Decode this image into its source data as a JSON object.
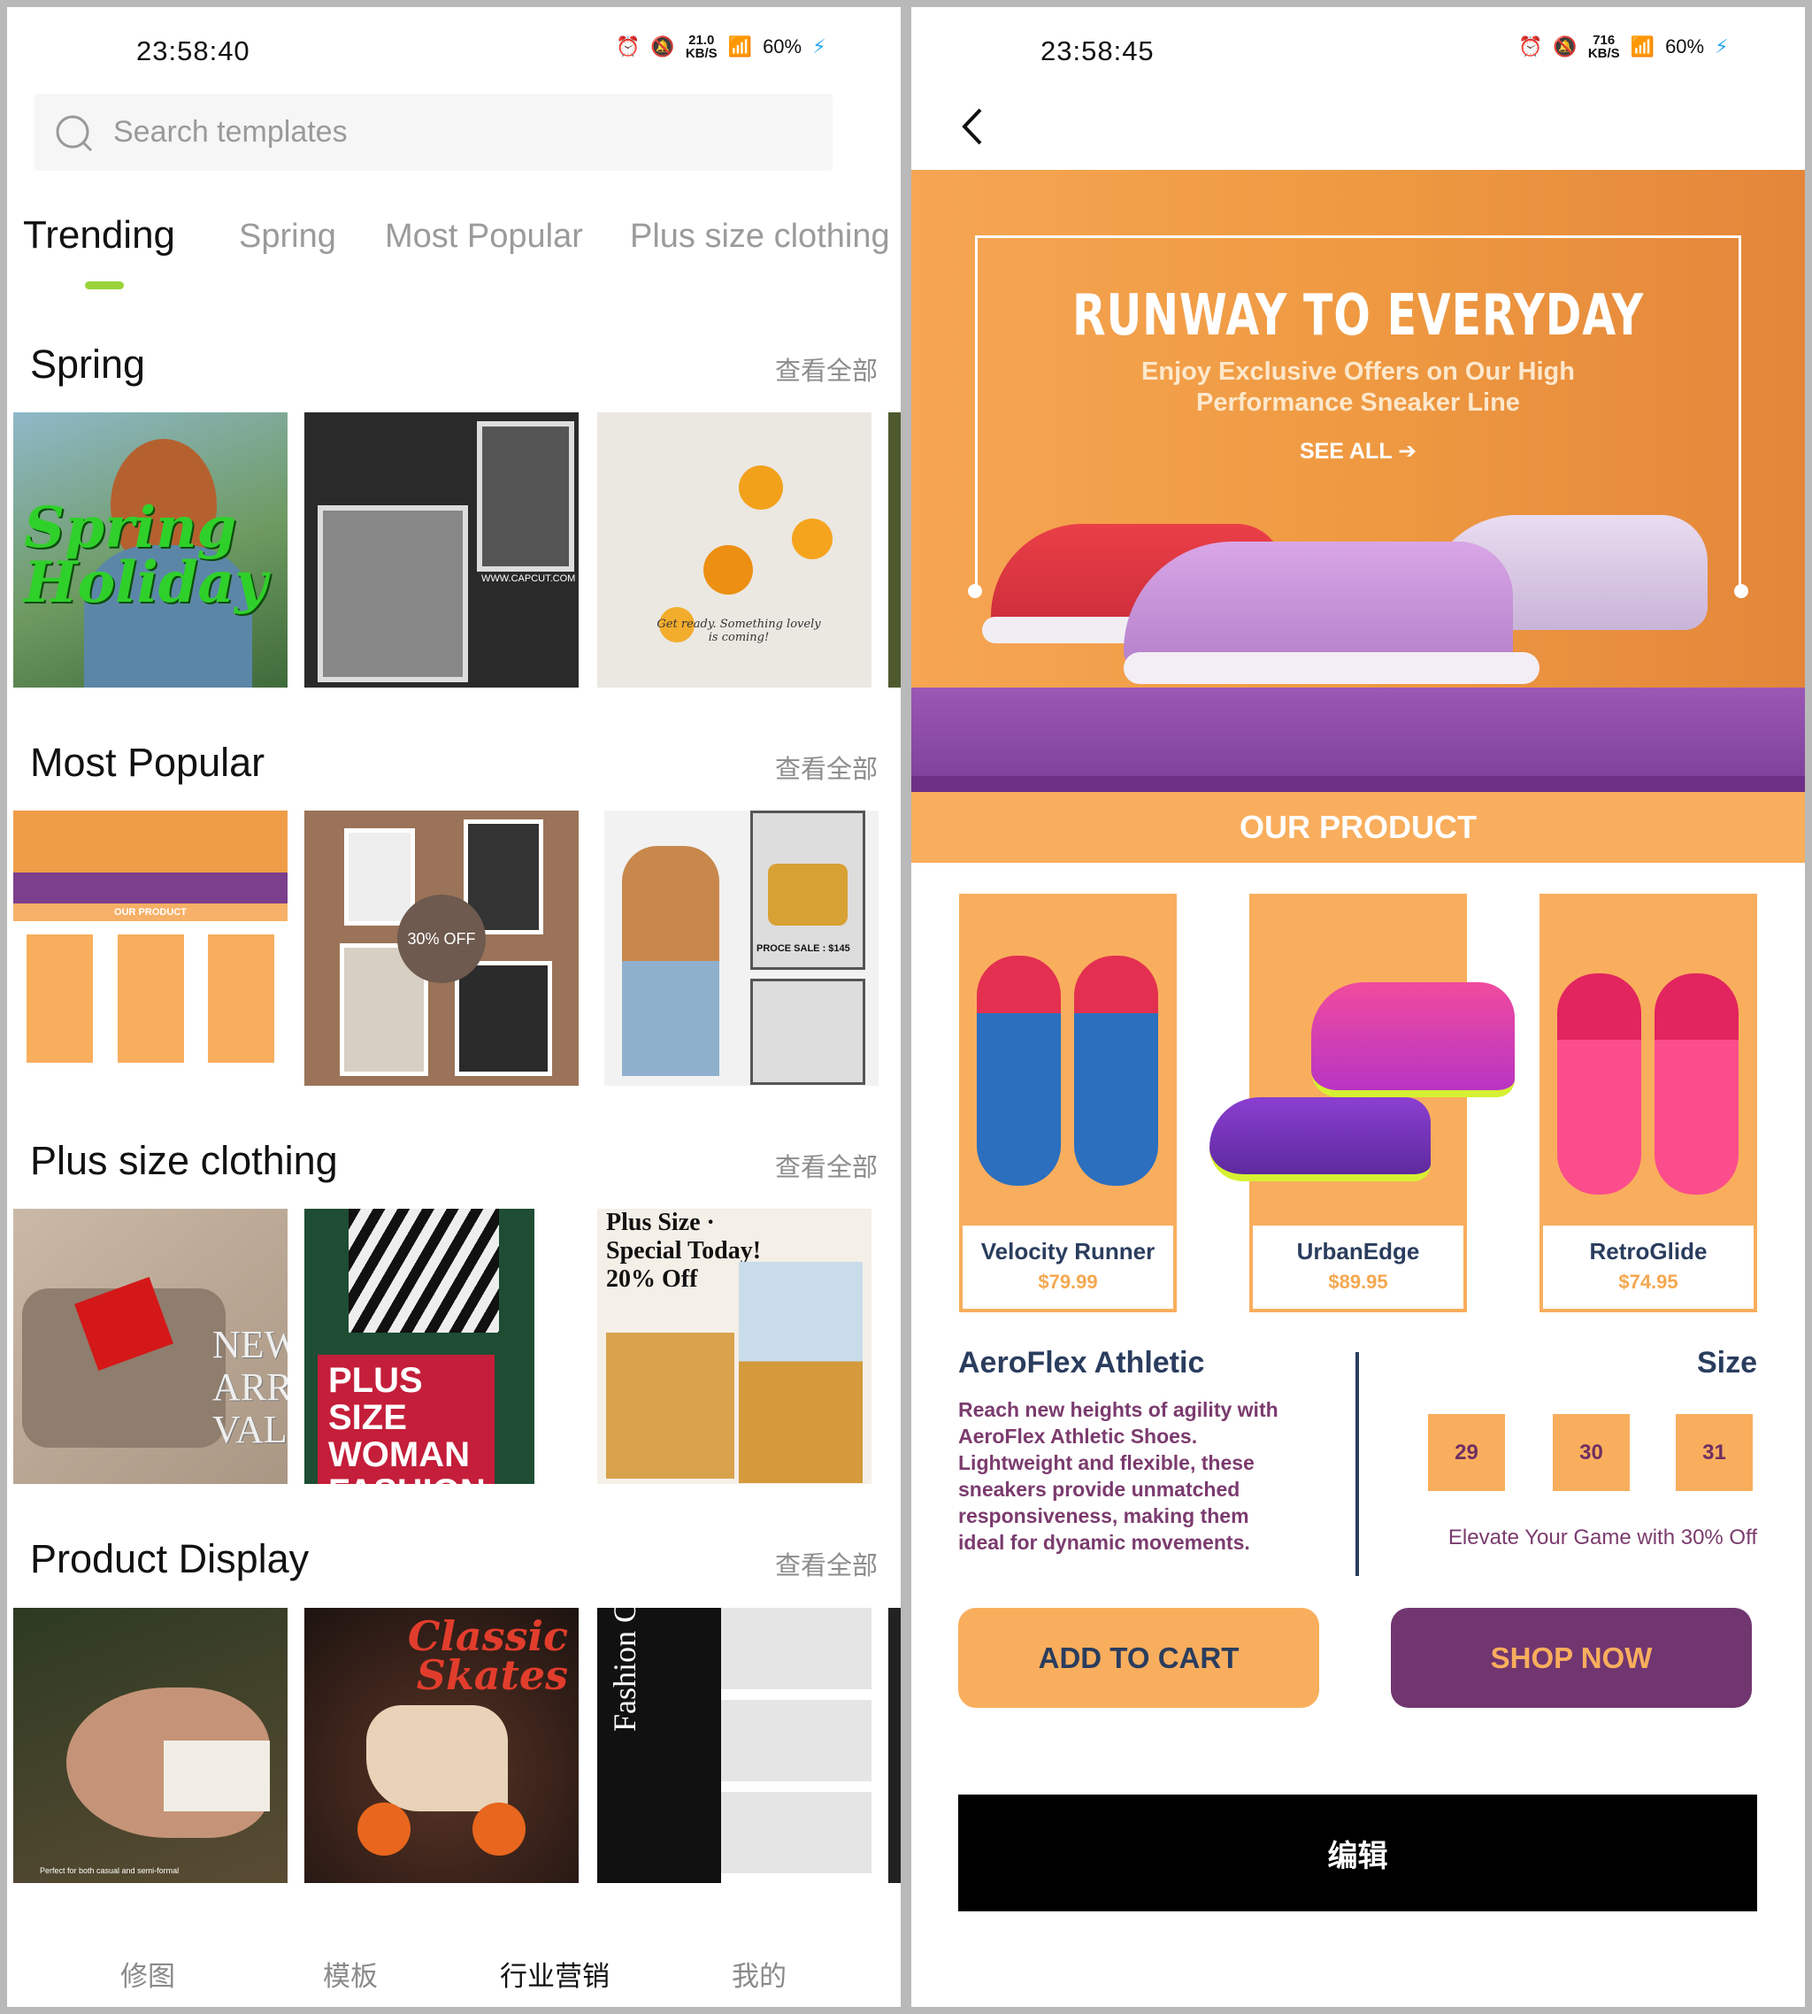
{
  "left_screen": {
    "status": {
      "time": "23:58:40",
      "speed": "21.0",
      "speed_unit": "KB/S",
      "battery": "60%"
    },
    "search": {
      "placeholder": "Search templates"
    },
    "tabs": [
      {
        "label": "Trending",
        "active": true
      },
      {
        "label": "Spring"
      },
      {
        "label": "Most Popular"
      },
      {
        "label": "Plus size clothing"
      }
    ],
    "accent_color": "#9ad43a",
    "sections": [
      {
        "title": "Spring",
        "see_all": "查看全部",
        "thumbs": [
          "Spring Holiday",
          "WWW.CAPCUT.COM",
          "Get ready. Something lovely is coming!"
        ]
      },
      {
        "title": "Most Popular",
        "see_all": "查看全部",
        "thumbs": [
          "OUR PRODUCT",
          "30% OFF",
          "PROCE SALE : $145"
        ]
      },
      {
        "title": "Plus size clothing",
        "see_all": "查看全部",
        "thumbs": [
          "NEW ARRI VAL",
          "PLUS SIZE WOMAN FASHION SALE",
          "Plus Size · Special Today! 20% Off"
        ]
      },
      {
        "title": "Product Display",
        "see_all": "查看全部",
        "thumbs": [
          "Perfect for both casual and semi-formal",
          "Classic Skates",
          "Fashion Collection"
        ]
      }
    ],
    "bottom_nav": [
      {
        "label": "修图"
      },
      {
        "label": "模板"
      },
      {
        "label": "行业营销",
        "active": true
      },
      {
        "label": "我的"
      }
    ]
  },
  "right_screen": {
    "status": {
      "time": "23:58:45",
      "speed": "716",
      "speed_unit": "KB/S",
      "battery": "60%"
    },
    "banner": {
      "title": "RUNWAY TO EVERYDAY",
      "subtitle_1": "Enjoy Exclusive Offers on Our High",
      "subtitle_2": "Performance Sneaker Line",
      "see_all": "SEE ALL ➔",
      "section_label": "OUR PRODUCT"
    },
    "products": [
      {
        "name": "Velocity Runner",
        "price": "$79.99"
      },
      {
        "name": "UrbanEdge",
        "price": "$89.95"
      },
      {
        "name": "RetroGlide",
        "price": "$74.95"
      }
    ],
    "detail": {
      "title": "AeroFlex Athletic",
      "description": "Reach new heights of agility with AeroFlex Athletic Shoes. Lightweight and flexible, these sneakers provide unmatched responsiveness, making them ideal for dynamic movements.",
      "size_label": "Size",
      "sizes": [
        "29",
        "30",
        "31"
      ],
      "promo": "Elevate Your Game with 30% Off"
    },
    "buttons": {
      "add_to_cart": "ADD TO CART",
      "shop_now": "SHOP NOW",
      "edit": "编辑"
    },
    "colors": {
      "orange": "#f9ae5d",
      "purple": "#713670",
      "navy": "#2a3d5e"
    }
  }
}
